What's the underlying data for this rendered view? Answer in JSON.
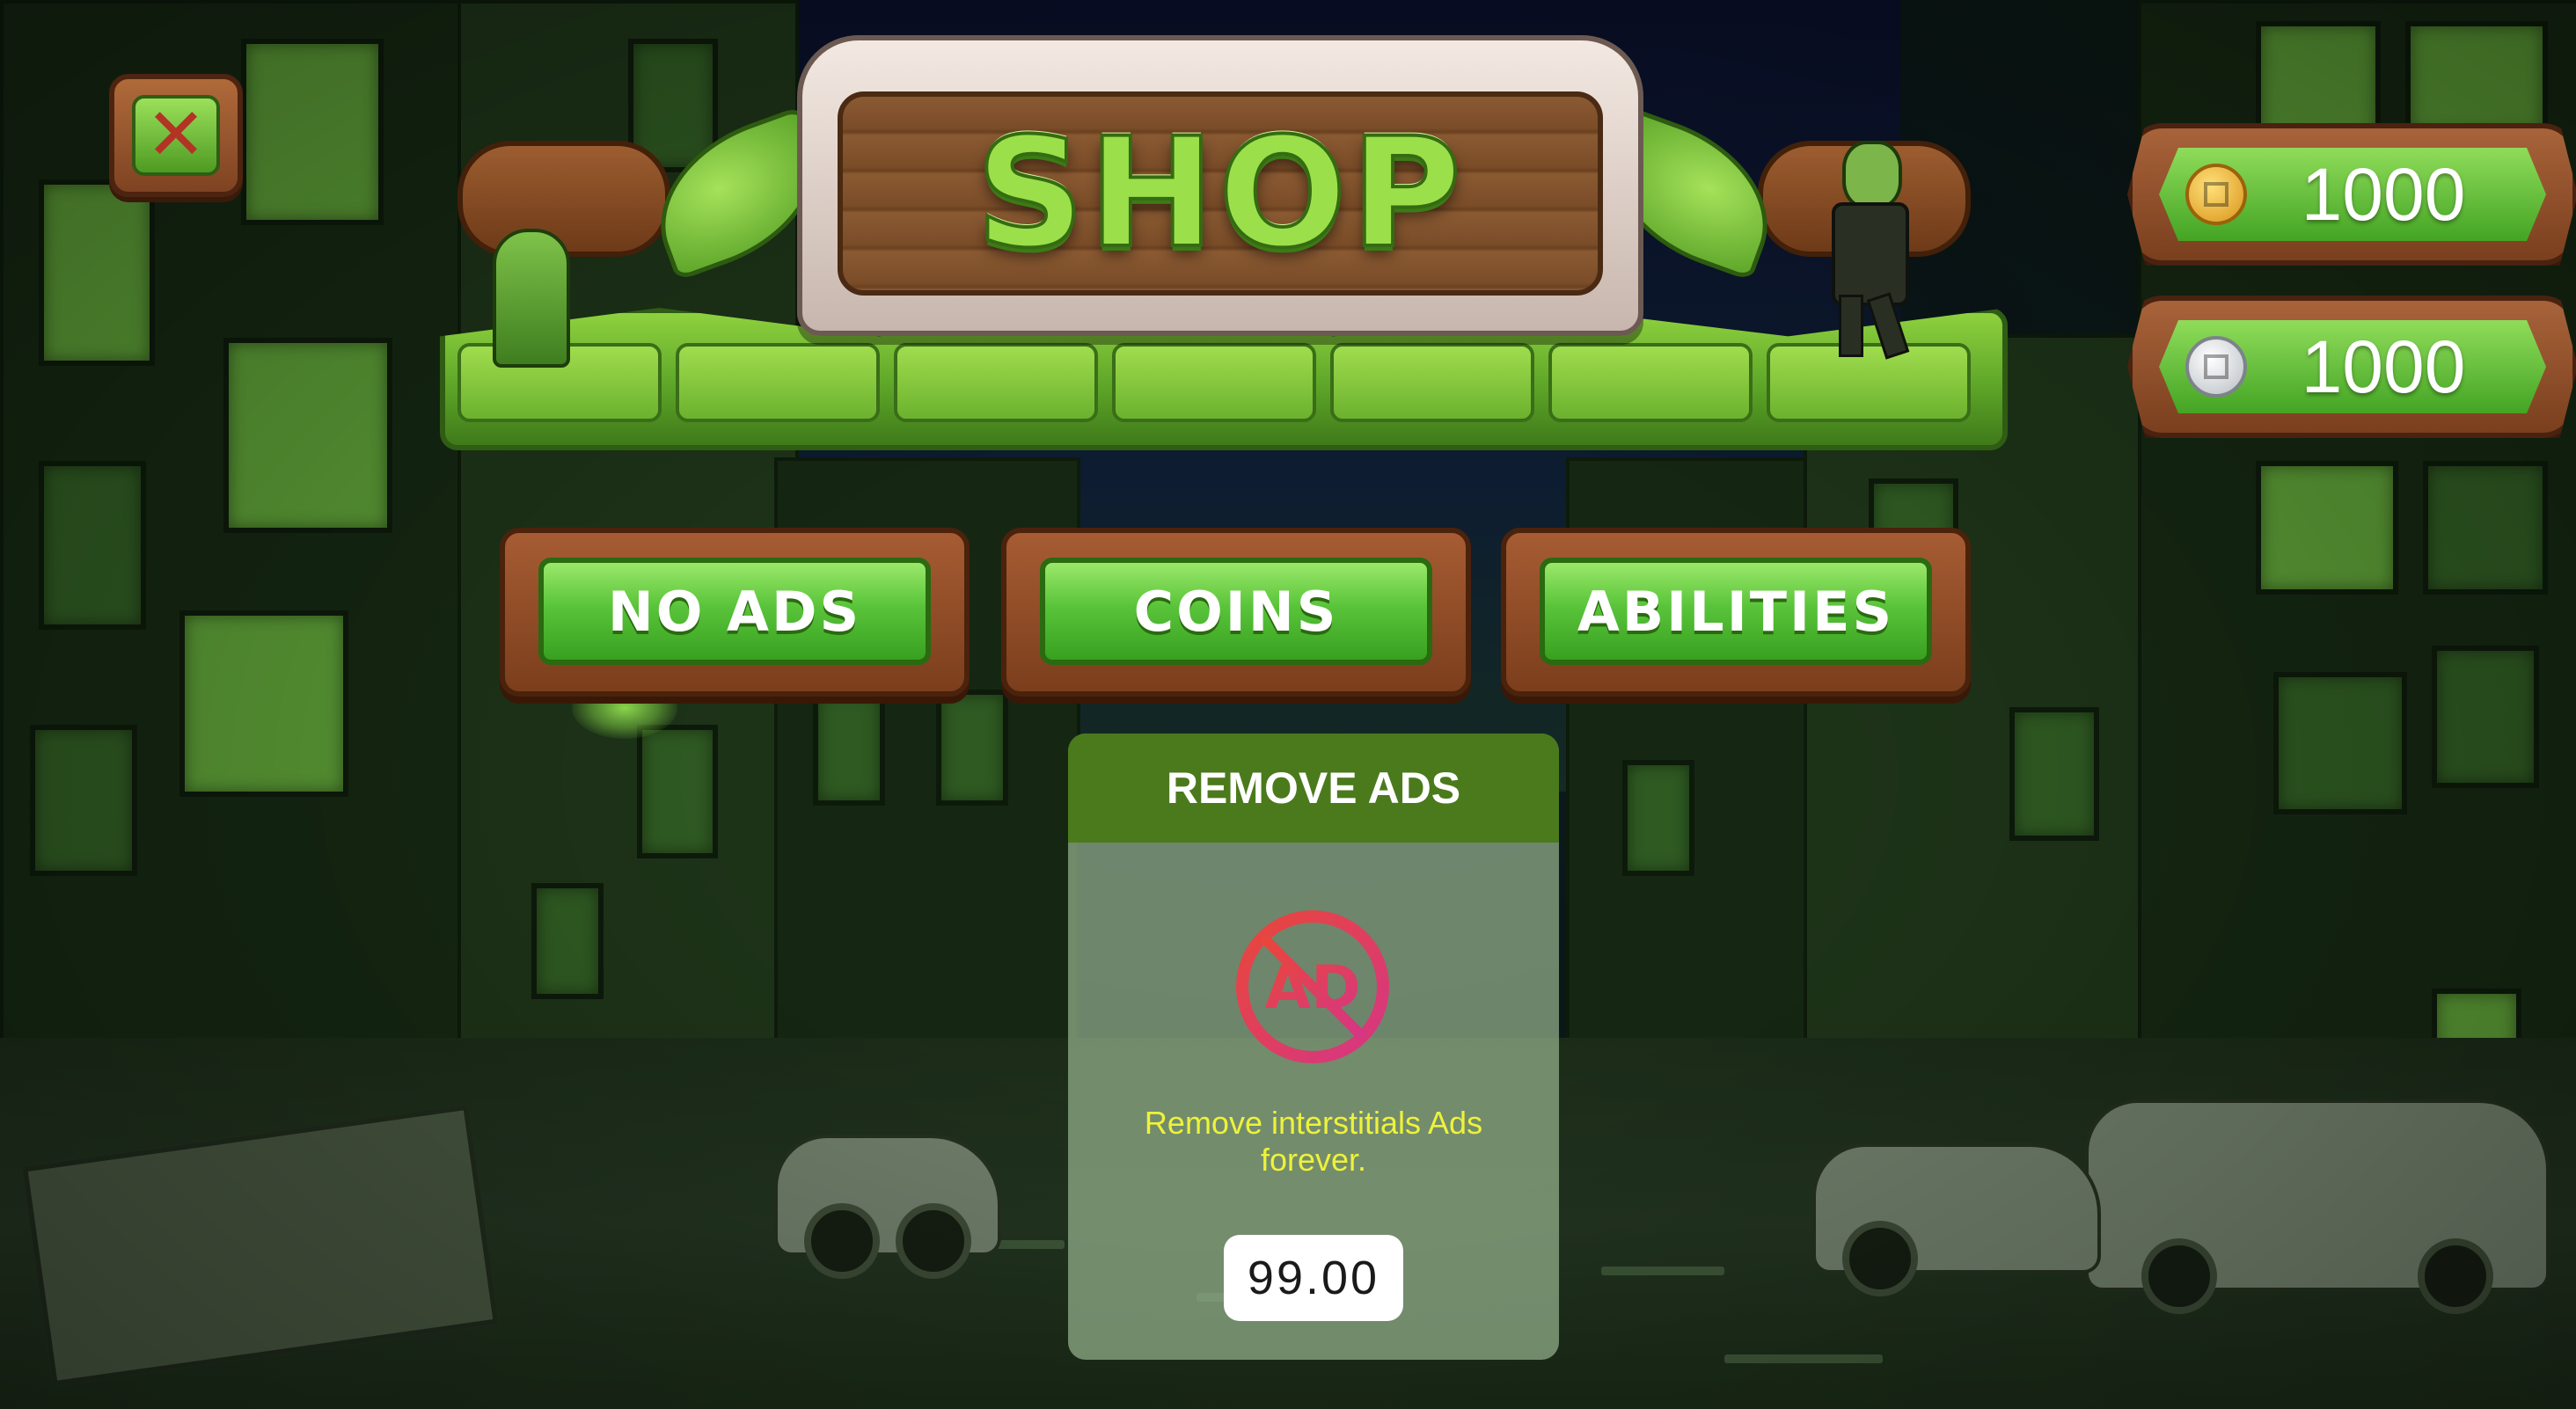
{
  "header": {
    "title": "SHOP"
  },
  "close_button": {
    "symbol": "✕"
  },
  "currencies": [
    {
      "type": "gold-coin",
      "amount": "1000"
    },
    {
      "type": "silver-coin",
      "amount": "1000"
    }
  ],
  "tabs": [
    {
      "label": "NO ADS"
    },
    {
      "label": "COINS"
    },
    {
      "label": "ABILITIES"
    }
  ],
  "product": {
    "title": "REMOVE ADS",
    "icon": "no-ads-icon",
    "icon_text": "AD",
    "description": "Remove interstitials Ads forever.",
    "price": "99.00"
  },
  "colors": {
    "accent_green": "#5ec43a",
    "wood": "#7b3e1c",
    "card_header": "#4b7a1c",
    "description_text": "#eef23a",
    "ad_icon_gradient_start": "#e8473a",
    "ad_icon_gradient_end": "#d63684"
  }
}
